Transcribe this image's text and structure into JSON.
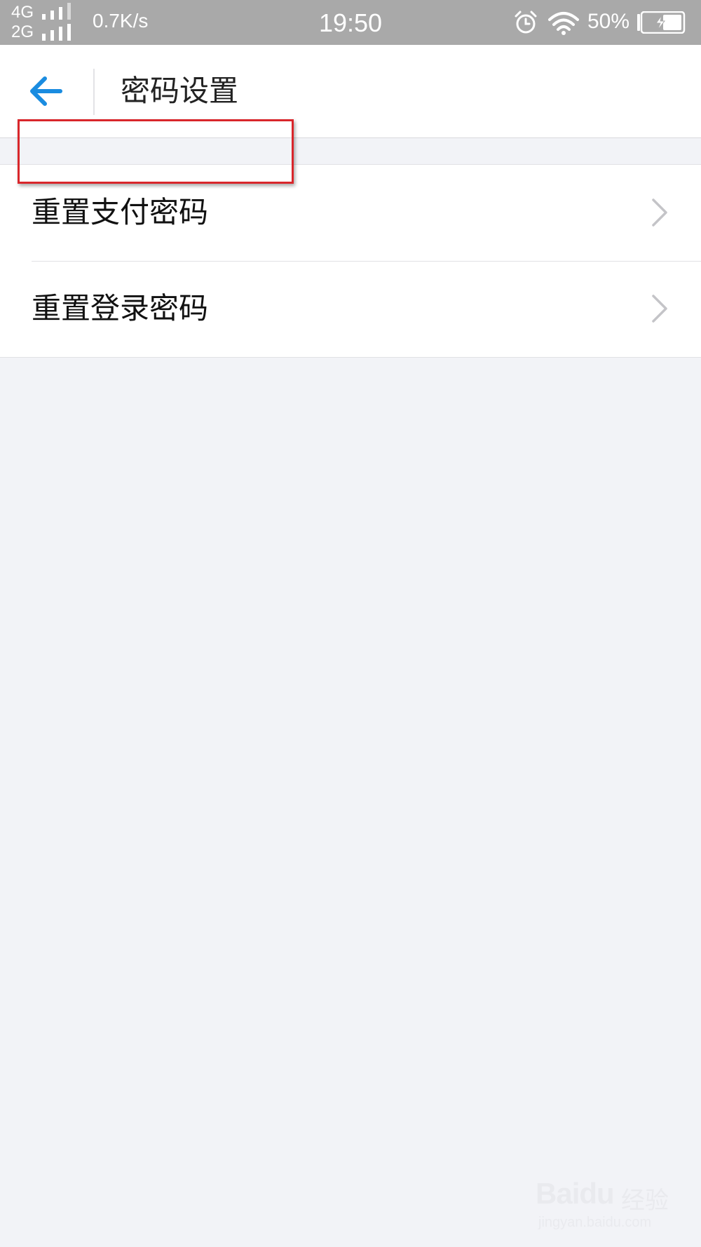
{
  "status_bar": {
    "network_top": "4G",
    "network_bottom": "2G",
    "speed": "0.7K/s",
    "time": "19:50",
    "battery": "50%"
  },
  "header": {
    "title": "密码设置",
    "back_icon": "arrow-left-icon",
    "accent_color": "#1a8ce0"
  },
  "list": {
    "items": [
      {
        "label": "重置支付密码",
        "icon": "chevron-right-icon"
      },
      {
        "label": "重置登录密码",
        "icon": "chevron-right-icon",
        "highlighted": true
      }
    ]
  },
  "annotation": {
    "highlight_color": "#d9262b"
  },
  "watermark": {
    "logo": "Baidu",
    "logo_cn": "经验",
    "url": "jingyan.baidu.com"
  }
}
